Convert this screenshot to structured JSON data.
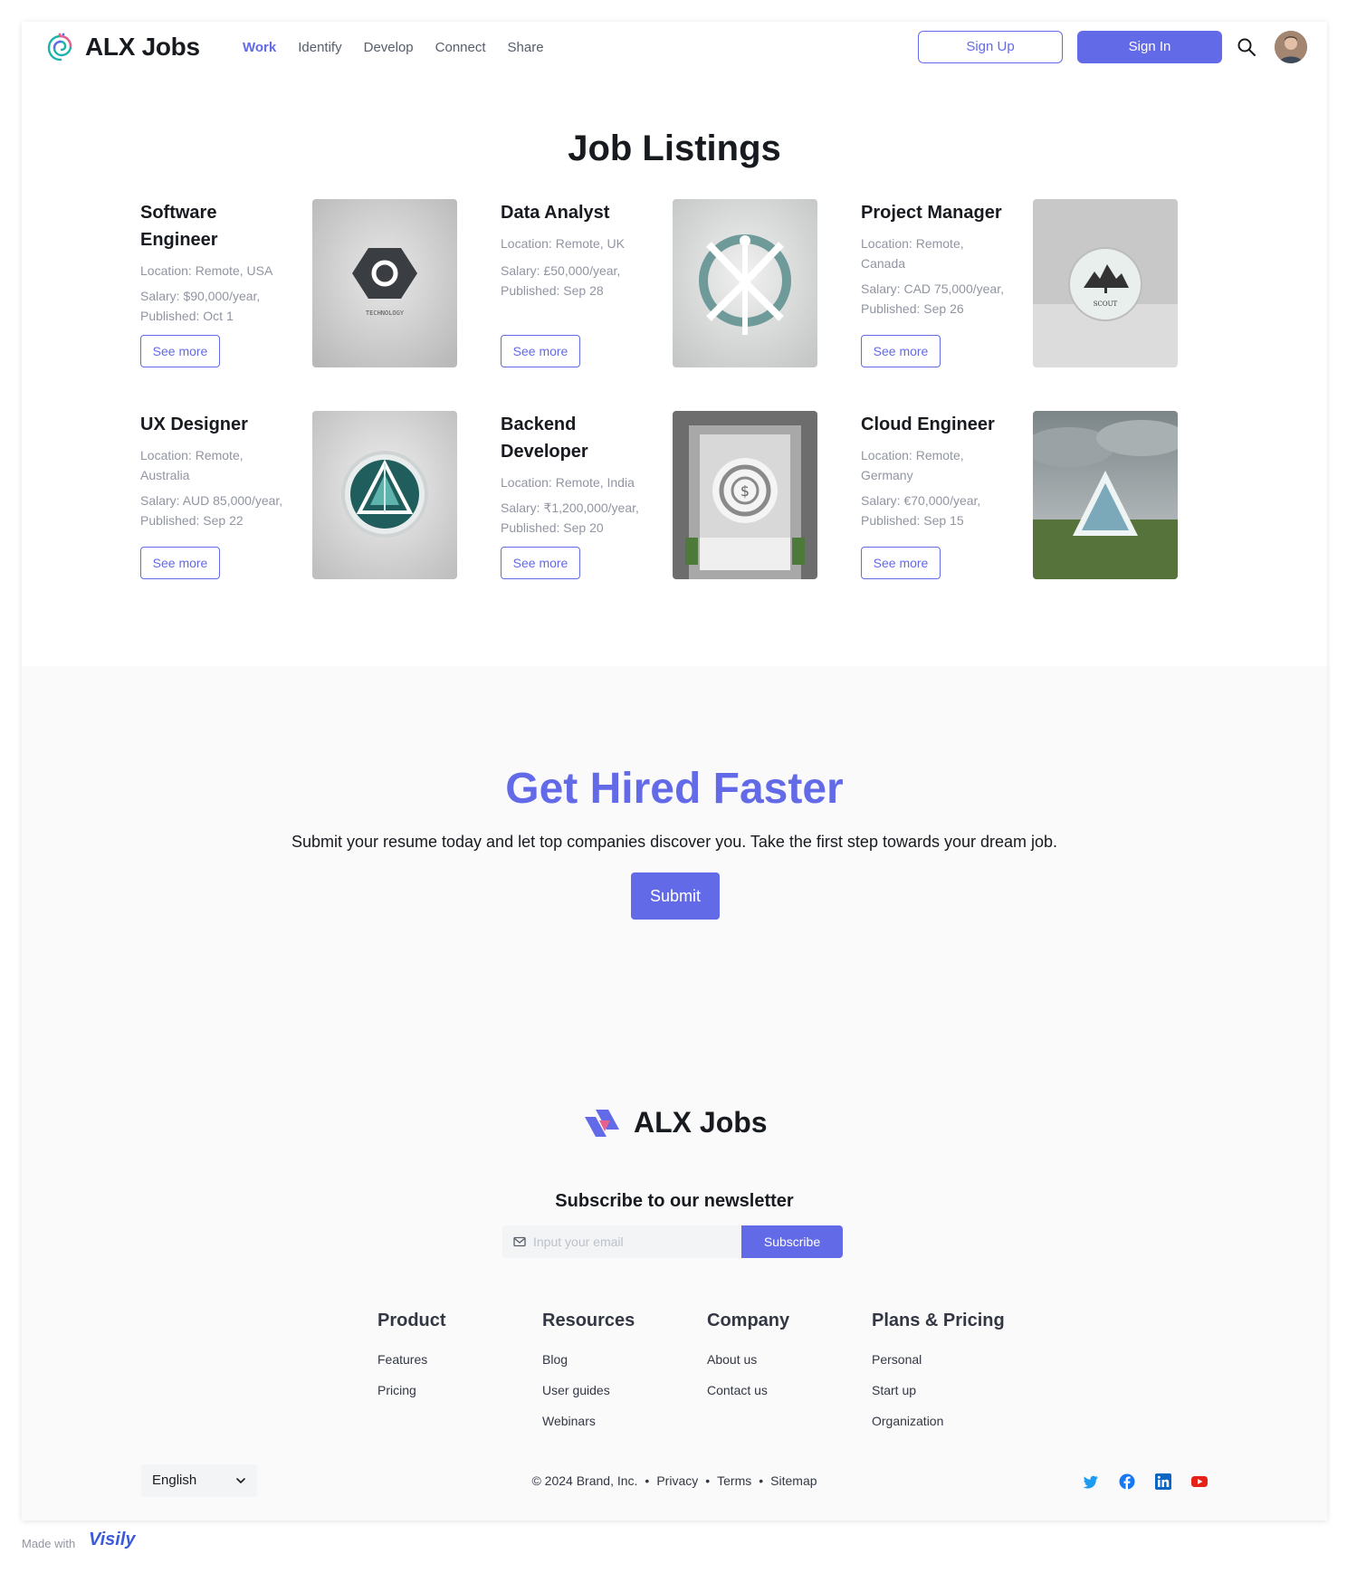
{
  "app": {
    "name": "ALX Jobs"
  },
  "nav": {
    "items": [
      {
        "label": "Work",
        "active": true
      },
      {
        "label": "Identify",
        "active": false
      },
      {
        "label": "Develop",
        "active": false
      },
      {
        "label": "Connect",
        "active": false
      },
      {
        "label": "Share",
        "active": false
      }
    ],
    "sign_up": "Sign Up",
    "sign_in": "Sign In"
  },
  "listings": {
    "title": "Job Listings",
    "see_more": "See more",
    "jobs": [
      {
        "title": "Software Engineer",
        "location": "Location: Remote, USA",
        "salary": "Salary: $90,000/year, Published: Oct 1",
        "logo": "tech-logo"
      },
      {
        "title": "Data Analyst",
        "location": "Location: Remote, UK",
        "salary": "Salary: £50,000/year, Published: Sep 28",
        "logo": "analytics-logo"
      },
      {
        "title": "Project Manager",
        "location": "Location: Remote, Canada",
        "salary": "Salary: CAD 75,000/year, Published: Sep 26",
        "logo": "tree-logo"
      },
      {
        "title": "UX Designer",
        "location": "Location: Remote, Australia",
        "salary": "Salary: AUD 85,000/year, Published: Sep 22",
        "logo": "crystal-logo"
      },
      {
        "title": "Backend Developer",
        "location": "Location: Remote, India",
        "salary": "Salary: ₹1,200,000/year, Published: Sep 20",
        "logo": "dollar-logo"
      },
      {
        "title": "Cloud Engineer",
        "location": "Location: Remote, Germany",
        "salary": "Salary: €70,000/year, Published: Sep 15",
        "logo": "triangle-landscape"
      }
    ]
  },
  "hero": {
    "title": "Get Hired Faster",
    "text": "Submit your resume today and let top companies discover you. Take the first step towards your dream job.",
    "button": "Submit"
  },
  "footer": {
    "brand": "ALX Jobs",
    "newsletter_title": "Subscribe to our newsletter",
    "email_placeholder": "Input your email",
    "subscribe": "Subscribe",
    "columns": [
      {
        "title": "Product",
        "links": [
          "Features",
          "Pricing"
        ]
      },
      {
        "title": "Resources",
        "links": [
          "Blog",
          "User guides",
          "Webinars"
        ]
      },
      {
        "title": "Company",
        "links": [
          "About us",
          "Contact us"
        ]
      },
      {
        "title": "Plans & Pricing",
        "links": [
          "Personal",
          "Start up",
          "Organization"
        ]
      }
    ],
    "language": "English",
    "copyright": "© 2024 Brand, Inc.",
    "legal_links": [
      "Privacy",
      "Terms",
      "Sitemap"
    ],
    "social": [
      "twitter-icon",
      "facebook-icon",
      "linkedin-icon",
      "youtube-icon"
    ]
  },
  "made_with": {
    "label": "Made with",
    "brand": "Visily"
  },
  "colors": {
    "primary": "#636ae8",
    "text": "#171a1f",
    "muted": "#9095a1"
  }
}
